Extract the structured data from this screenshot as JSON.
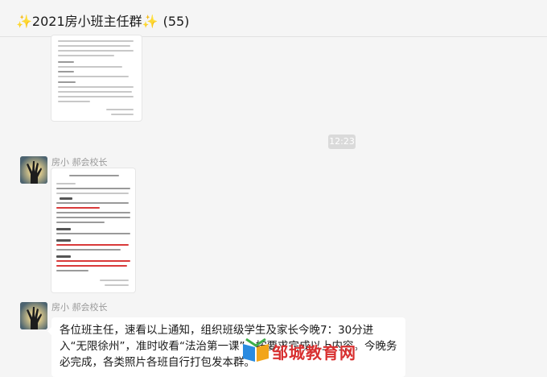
{
  "window": {
    "title_spark_left": "✨",
    "title": "2021房小班主任群",
    "title_spark_right": "✨",
    "member_count": "(55)"
  },
  "messages": [
    {
      "type": "image",
      "sender": "",
      "description": ""
    },
    {
      "type": "time",
      "time": "12:23"
    },
    {
      "type": "image",
      "sender": "房小 郝会校长",
      "doc_heading": "关于组织“法治第一课”活动的通知"
    },
    {
      "type": "text",
      "sender": "房小 郝会校长",
      "text": "各位班主任，速看以上通知，组织班级学生及家长今晚7：30分进入“无限徐州”，准时收看“法治第一课”。按要求完成以上内容。今晚务必完成，各类照片各班自行打包发本群。"
    }
  ],
  "watermark": {
    "text": "邹城教育网"
  },
  "colors": {
    "background": "#f5f5f5",
    "bubble": "#ffffff",
    "time_pill": "#dadada",
    "watermark": "#d83030"
  }
}
